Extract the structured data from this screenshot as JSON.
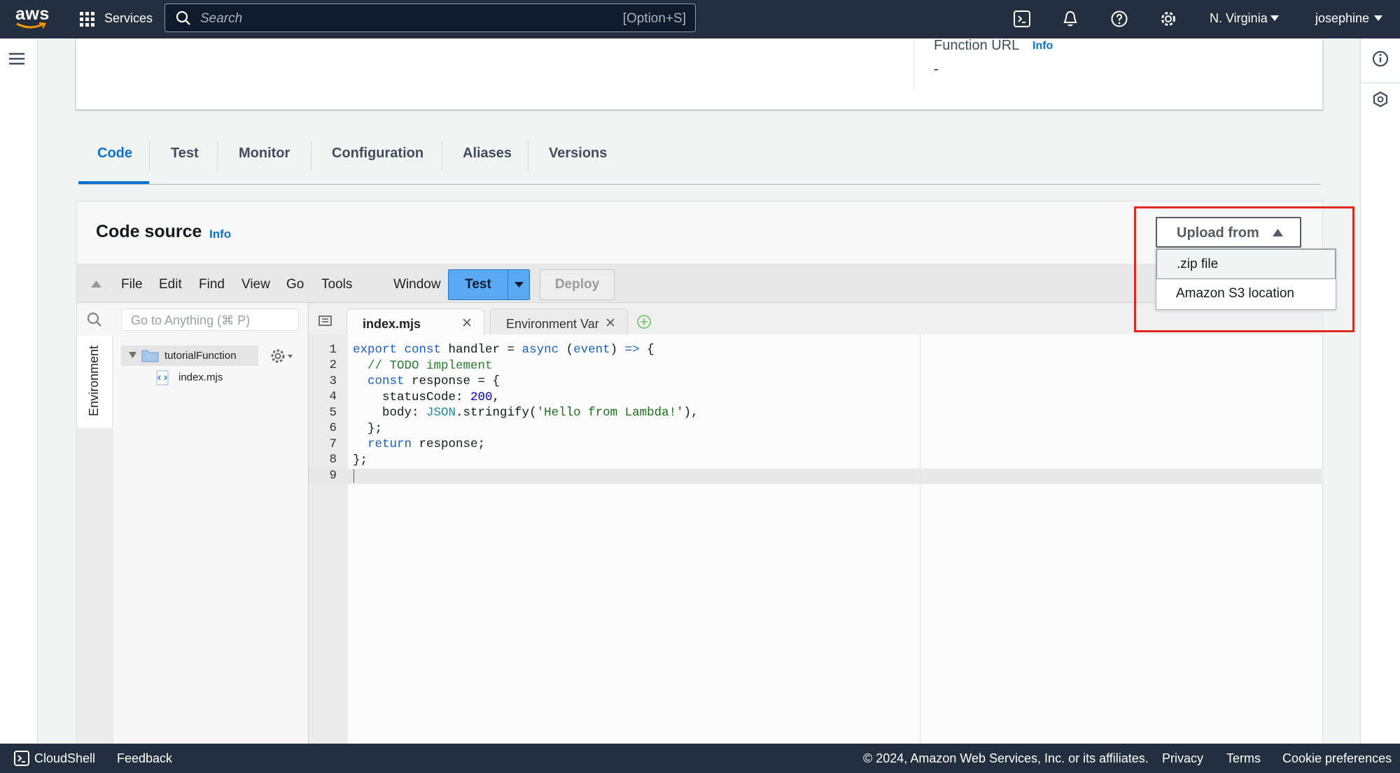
{
  "topnav": {
    "logo": "aws",
    "services": "Services",
    "search_placeholder": "Search",
    "search_shortcut": "[Option+S]",
    "region": "N. Virginia",
    "user": "josephine"
  },
  "function_url": {
    "label": "Function URL",
    "info": "Info",
    "value": "-"
  },
  "tabs": [
    "Code",
    "Test",
    "Monitor",
    "Configuration",
    "Aliases",
    "Versions"
  ],
  "active_tab": "Code",
  "code_source": {
    "title": "Code source",
    "info": "Info",
    "upload_button": "Upload from",
    "upload_options": [
      ".zip file",
      "Amazon S3 location"
    ]
  },
  "ide": {
    "menu": [
      "File",
      "Edit",
      "Find",
      "View",
      "Go",
      "Tools",
      "Window"
    ],
    "test_button": "Test",
    "deploy_button": "Deploy",
    "goto_placeholder": "Go to Anything (⌘ P)",
    "side_tab": "Environment",
    "folder": "tutorialFunction",
    "file": "index.mjs",
    "editor_tabs": [
      "index.mjs",
      "Environment Var"
    ],
    "line_numbers": [
      "1",
      "2",
      "3",
      "4",
      "5",
      "6",
      "7",
      "8",
      "9"
    ]
  },
  "footer": {
    "cloudshell": "CloudShell",
    "feedback": "Feedback",
    "copyright": "© 2024, Amazon Web Services, Inc. or its affiliates.",
    "privacy": "Privacy",
    "terms": "Terms",
    "cookies": "Cookie preferences"
  },
  "colors": {
    "nav": "#232f3e",
    "accent": "#0972d3",
    "highlight": "#e02a1f",
    "test_button": "#5aa9f5"
  }
}
